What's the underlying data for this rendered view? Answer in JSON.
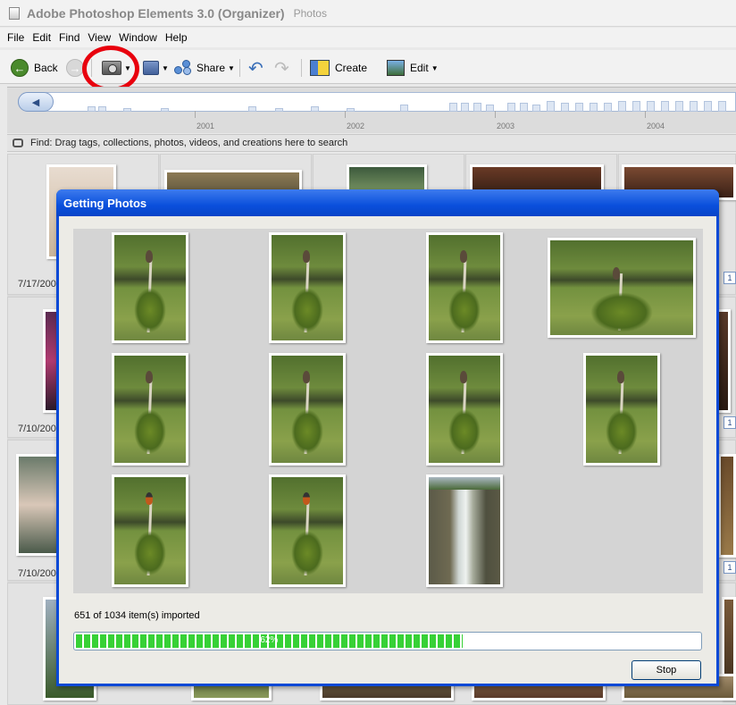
{
  "window": {
    "title": "Adobe Photoshop Elements 3.0 (Organizer)",
    "subtitle": "Photos"
  },
  "menu": [
    "File",
    "Edit",
    "Find",
    "View",
    "Window",
    "Help"
  ],
  "toolbar": {
    "back_label": "Back",
    "share_label": "Share",
    "create_label": "Create",
    "edit_label": "Edit"
  },
  "timeline": {
    "years": [
      "2001",
      "2002",
      "2003",
      "2004"
    ]
  },
  "find": {
    "text": "Find: Drag tags, collections, photos, videos, and creations here to search"
  },
  "background_grid": {
    "dates": [
      "7/17/200",
      "7/10/200",
      "7/10/200"
    ],
    "badge": "1"
  },
  "dialog": {
    "title": "Getting Photos",
    "status": "651 of 1034 item(s) imported",
    "progress_percent": 62,
    "progress_text": "62%",
    "stop_label": "Stop"
  },
  "colors": {
    "highlight_ring": "#e8000d",
    "dialog_title": "#0a4fdc",
    "progress_fill": "#37d136"
  }
}
